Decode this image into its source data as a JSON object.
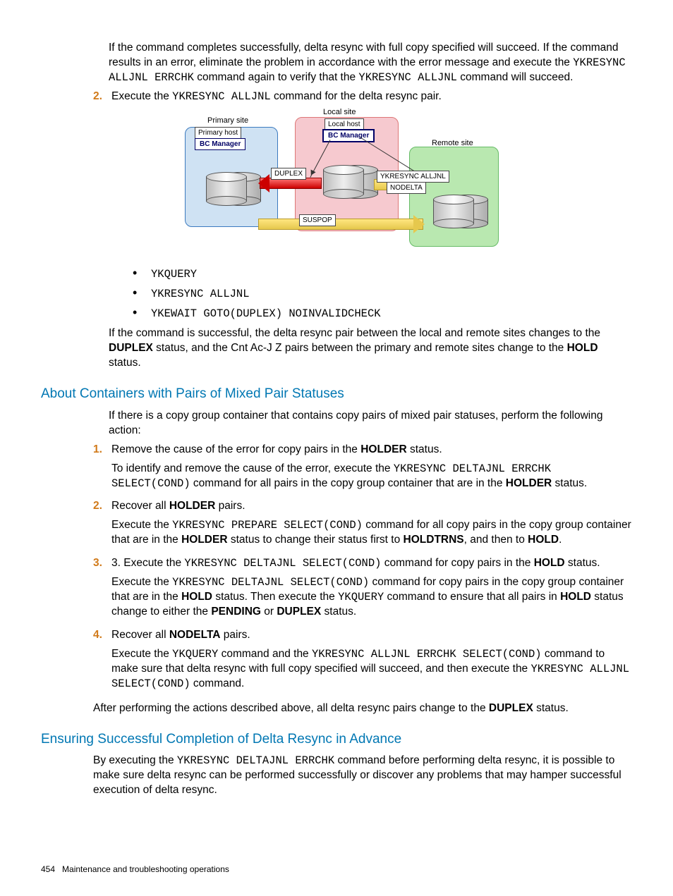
{
  "intro": {
    "p1a": "If the command completes successfully, delta resync with full copy specified will succeed. If the command results in an error, eliminate the problem in accordance with the error message and execute the ",
    "p1code1": "YKRESYNC ALLJNL ERRCHK",
    "p1b": " command again to verify that the ",
    "p1code2": "YKRESYNC ALLJNL",
    "p1c": " command will succeed."
  },
  "step2": {
    "num": "2.",
    "a": "Execute the ",
    "code": "YKRESYNC ALLJNL",
    "b": " command for the delta resync pair."
  },
  "diagram": {
    "primary_site": "Primary site",
    "primary_host": "Primary host",
    "local_site": "Local site",
    "local_host": "Local host",
    "remote_site": "Remote site",
    "bc_manager": "BC Manager",
    "duplex": "DUPLEX",
    "ykresync": "YKRESYNC  ALLJNL",
    "nodelta": "NODELTA",
    "suspop": "SUSPOP"
  },
  "bullets": {
    "b1": "YKQUERY",
    "b2": "YKRESYNC ALLJNL",
    "b3": "YKEWAIT GOTO(DUPLEX) NOINVALIDCHECK"
  },
  "post_bullets": {
    "a": "If the command is successful, the delta resync pair between the local and remote sites changes to the ",
    "duplex": "DUPLEX",
    "b": " status, and the Cnt Ac-J Z pairs between the primary and remote sites change to the ",
    "hold": "HOLD",
    "c": " status."
  },
  "h_mixed": "About Containers with Pairs of Mixed Pair Statuses",
  "mixed_intro": "If there is a copy group container that contains copy pairs of mixed pair statuses, perform the following action:",
  "m1": {
    "num": "1.",
    "line_a": "Remove the cause of the error for copy pairs in the ",
    "holder": "HOLDER",
    "line_b": " status.",
    "p2a": "To identify and remove the cause of the error, execute the ",
    "p2code": "YKRESYNC DELTAJNL ERRCHK SELECT(COND)",
    "p2b": " command for all pairs in the copy group container that are in the ",
    "p2c": " status."
  },
  "m2": {
    "num": "2.",
    "line_a": "Recover all ",
    "holder": "HOLDER",
    "line_b": " pairs.",
    "p2a": "Execute the ",
    "p2code": "YKRESYNC PREPARE SELECT(COND)",
    "p2b": " command for all copy pairs in the copy group container that are in the ",
    "p2c": " status to change their status first to ",
    "holdtrns": "HOLDTRNS",
    "p2d": ", and then to ",
    "hold": "HOLD",
    "p2e": "."
  },
  "m3": {
    "num": "3.",
    "line_a": "3. Execute the ",
    "code1": "YKRESYNC DELTAJNL SELECT(COND)",
    "line_b": " command for copy pairs in the ",
    "hold": "HOLD",
    "line_c": " status.",
    "p2a": "Execute the ",
    "p2b": " command for copy pairs in the copy group container that are in the ",
    "p2c": " status. Then execute the ",
    "code2": "YKQUERY",
    "p2d": " command to ensure that all pairs in ",
    "p2e": " status change to either the ",
    "pending": "PENDING",
    "p2f": " or ",
    "duplex": "DUPLEX",
    "p2g": " status."
  },
  "m4": {
    "num": "4.",
    "line_a": "Recover all ",
    "nodelta": "NODELTA",
    "line_b": " pairs.",
    "p2a": "Execute the ",
    "code1": "YKQUERY",
    "p2b": " command and the ",
    "code2": "YKRESYNC ALLJNL ERRCHK SELECT(COND)",
    "p2c": " command to make sure that delta resync with full copy specified will succeed, and then execute the ",
    "code3": "YKRESYNC ALLJNL SELECT(COND)",
    "p2d": " command."
  },
  "mixed_close": {
    "a": "After performing the actions described above, all delta resync pairs change to the ",
    "duplex": "DUPLEX",
    "b": " status."
  },
  "h_ensure": "Ensuring Successful Completion of Delta Resync in Advance",
  "ensure": {
    "a": "By executing the ",
    "code": "YKRESYNC DELTAJNL ERRCHK",
    "b": " command before performing delta resync, it is possible to make sure delta resync can be performed successfully or discover any problems that may hamper successful execution of delta resync."
  },
  "footer": {
    "pageno": "454",
    "title": "Maintenance and troubleshooting operations"
  }
}
